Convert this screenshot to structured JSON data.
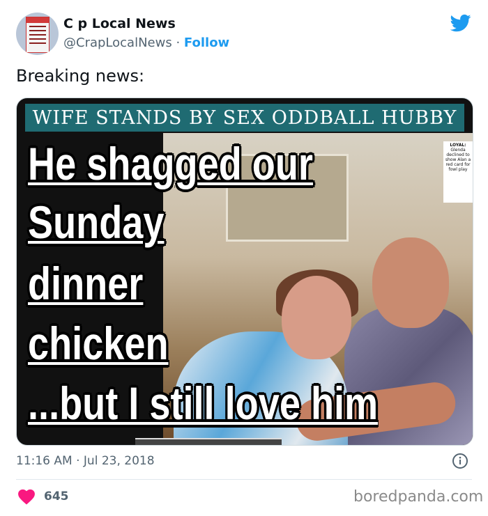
{
  "tweet": {
    "display_name": "C  p Local News",
    "handle": "@CrapLocalNews",
    "separator": "·",
    "follow_label": "Follow",
    "text": "Breaking news:",
    "timestamp": "11:16 AM · Jul 23, 2018",
    "like_count": "645"
  },
  "media": {
    "banner": "WIFE STANDS BY SEX ODDBALL HUBBY",
    "headline_lines": [
      "He shagged our",
      "Sunday",
      "dinner",
      "chicken",
      "...but I still love him"
    ],
    "photo_caption": {
      "head": "LOYAL:",
      "body": "Glenda declined to show Alan a red card for fowl play"
    }
  },
  "footer": {
    "watermark": "boredpanda.com"
  },
  "colors": {
    "twitter_blue": "#1d9bf0",
    "like_pink": "#f91880",
    "banner_teal": "#1f6b72",
    "muted_text": "#536471"
  },
  "icons": [
    "twitter-bird-icon",
    "info-icon",
    "heart-icon"
  ]
}
